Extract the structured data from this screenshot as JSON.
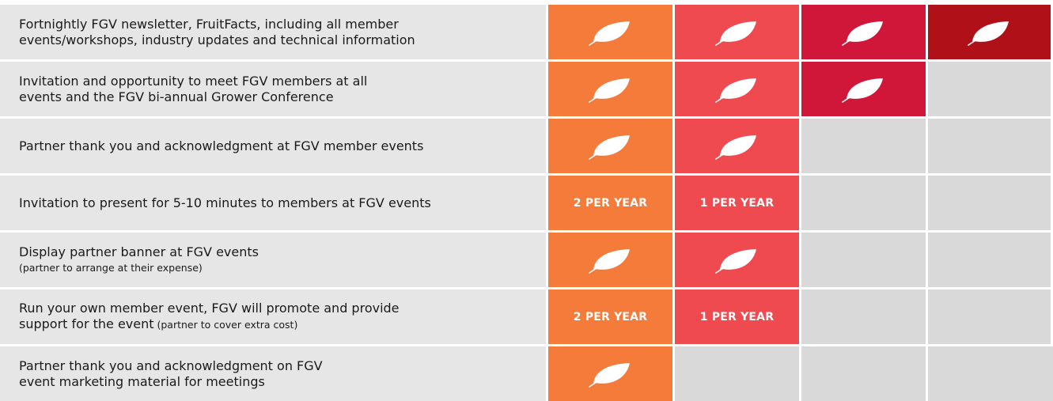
{
  "rows": [
    {
      "lines": [
        "Fortnightly FGV newsletter, FruitFacts, including all member",
        "events/workshops, industry updates and technical information"
      ],
      "cells": [
        {
          "fill": "#f47b3a",
          "icon": "leaf-icon"
        },
        {
          "fill": "#ef4a4f",
          "icon": "leaf-icon"
        },
        {
          "fill": "#d0173a",
          "icon": "leaf-icon"
        },
        {
          "fill": "#b01018",
          "icon": "leaf-icon"
        }
      ]
    },
    {
      "lines": [
        "Invitation and opportunity to meet FGV members at all",
        "events and the FGV bi-annual Grower Conference"
      ],
      "cells": [
        {
          "fill": "#f47b3a",
          "icon": "leaf-icon"
        },
        {
          "fill": "#ef4a4f",
          "icon": "leaf-icon"
        },
        {
          "fill": "#d0173a",
          "icon": "leaf-icon"
        },
        {
          "fill": "#d9d9da"
        }
      ]
    },
    {
      "lines": [
        "Partner thank you and acknowledgment at FGV member events"
      ],
      "cells": [
        {
          "fill": "#f47b3a",
          "icon": "leaf-icon"
        },
        {
          "fill": "#ef4a4f",
          "icon": "leaf-icon"
        },
        {
          "fill": "#d9d9da"
        },
        {
          "fill": "#d9d9da"
        }
      ]
    },
    {
      "lines": [
        "Invitation to present for 5-10 minutes to members at FGV events"
      ],
      "cells": [
        {
          "fill": "#f47b3a",
          "text": "2 PER YEAR"
        },
        {
          "fill": "#ef4a4f",
          "text": "1 PER YEAR"
        },
        {
          "fill": "#d9d9da"
        },
        {
          "fill": "#d9d9da"
        }
      ]
    },
    {
      "lines": [
        "Display partner banner at FGV events"
      ],
      "note": "(partner to arrange at their expense)",
      "cells": [
        {
          "fill": "#f47b3a",
          "icon": "leaf-icon"
        },
        {
          "fill": "#ef4a4f",
          "icon": "leaf-icon"
        },
        {
          "fill": "#d9d9da"
        },
        {
          "fill": "#d9d9da"
        }
      ]
    },
    {
      "lines": [
        "Run your own member event, FGV will promote and provide",
        "support for the event"
      ],
      "inline_note": "(partner to cover extra cost)",
      "cells": [
        {
          "fill": "#f47b3a",
          "text": "2 PER YEAR"
        },
        {
          "fill": "#ef4a4f",
          "text": "1 PER YEAR"
        },
        {
          "fill": "#d9d9da"
        },
        {
          "fill": "#d9d9da"
        }
      ]
    },
    {
      "lines": [
        "Partner thank you and acknowledgment on FGV",
        "event marketing material for meetings"
      ],
      "cells": [
        {
          "fill": "#f47b3a",
          "icon": "leaf-icon"
        },
        {
          "fill": "#d9d9da"
        },
        {
          "fill": "#d9d9da"
        },
        {
          "fill": "#d9d9da"
        }
      ]
    }
  ]
}
